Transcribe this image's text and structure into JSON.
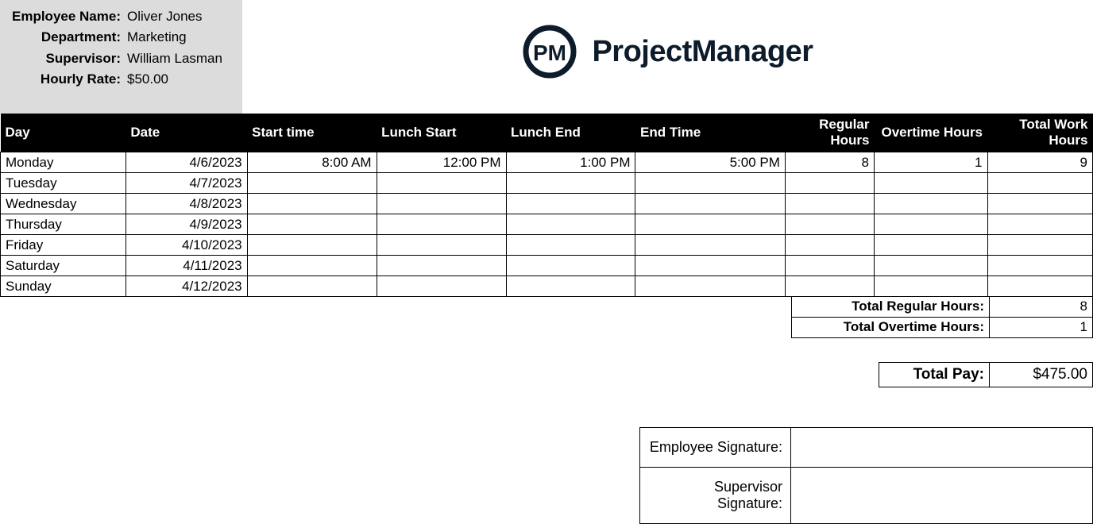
{
  "employee": {
    "name_label": "Employee Name:",
    "name_value": "Oliver Jones",
    "dept_label": "Department:",
    "dept_value": "Marketing",
    "super_label": "Supervisor:",
    "super_value": "William Lasman",
    "rate_label": "Hourly Rate:",
    "rate_value": "$50.00"
  },
  "brand": "ProjectManager",
  "columns": {
    "day": "Day",
    "date": "Date",
    "start": "Start time",
    "lunch_start": "Lunch Start",
    "lunch_end": "Lunch End",
    "end": "End Time",
    "regular": "Regular Hours",
    "overtime": "Overtime Hours",
    "total": "Total Work Hours"
  },
  "rows": [
    {
      "day": "Monday",
      "date": "4/6/2023",
      "start": "8:00 AM",
      "lunch_start": "12:00 PM",
      "lunch_end": "1:00 PM",
      "end": "5:00 PM",
      "regular": "8",
      "overtime": "1",
      "total": "9"
    },
    {
      "day": "Tuesday",
      "date": "4/7/2023",
      "start": "",
      "lunch_start": "",
      "lunch_end": "",
      "end": "",
      "regular": "",
      "overtime": "",
      "total": ""
    },
    {
      "day": "Wednesday",
      "date": "4/8/2023",
      "start": "",
      "lunch_start": "",
      "lunch_end": "",
      "end": "",
      "regular": "",
      "overtime": "",
      "total": ""
    },
    {
      "day": "Thursday",
      "date": "4/9/2023",
      "start": "",
      "lunch_start": "",
      "lunch_end": "",
      "end": "",
      "regular": "",
      "overtime": "",
      "total": ""
    },
    {
      "day": "Friday",
      "date": "4/10/2023",
      "start": "",
      "lunch_start": "",
      "lunch_end": "",
      "end": "",
      "regular": "",
      "overtime": "",
      "total": ""
    },
    {
      "day": "Saturday",
      "date": "4/11/2023",
      "start": "",
      "lunch_start": "",
      "lunch_end": "",
      "end": "",
      "regular": "",
      "overtime": "",
      "total": ""
    },
    {
      "day": "Sunday",
      "date": "4/12/2023",
      "start": "",
      "lunch_start": "",
      "lunch_end": "",
      "end": "",
      "regular": "",
      "overtime": "",
      "total": ""
    }
  ],
  "totals": {
    "regular_label": "Total Regular Hours:",
    "regular_value": "8",
    "overtime_label": "Total Overtime Hours:",
    "overtime_value": "1",
    "pay_label": "Total Pay:",
    "pay_value": "$475.00"
  },
  "signatures": {
    "employee_label": "Employee Signature:",
    "employee_value": "",
    "supervisor_label": "Supervisor Signature:",
    "supervisor_value": ""
  }
}
